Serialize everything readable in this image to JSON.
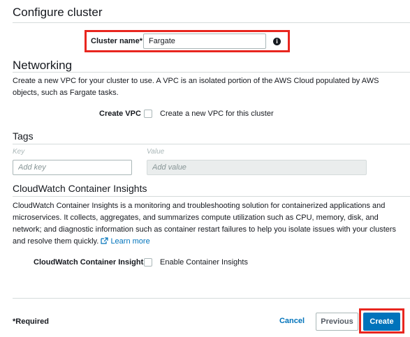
{
  "configure": {
    "title": "Configure cluster"
  },
  "cluster_name": {
    "label": "Cluster name*",
    "value": "Fargate",
    "info_icon": "info-icon"
  },
  "networking": {
    "title": "Networking",
    "description": "Create a new VPC for your cluster to use. A VPC is an isolated portion of the AWS Cloud populated by AWS objects, such as Fargate tasks.",
    "create_vpc_label": "Create VPC",
    "create_vpc_checkbox_label": "Create a new VPC for this cluster"
  },
  "tags": {
    "title": "Tags",
    "key_header": "Key",
    "value_header": "Value",
    "key_placeholder": "Add key",
    "value_placeholder": "Add value"
  },
  "insights": {
    "title": "CloudWatch Container Insights",
    "description": "CloudWatch Container Insights is a monitoring and troubleshooting solution for containerized applications and microservices. It collects, aggregates, and summarizes compute utilization such as CPU, memory, disk, and network; and diagnostic information such as container restart failures to help you isolate issues with your clusters and resolve them quickly.",
    "learn_more": "Learn more",
    "label": "CloudWatch Container Insights",
    "checkbox_label": "Enable Container Insights"
  },
  "footer": {
    "required_note": "*Required",
    "cancel": "Cancel",
    "previous": "Previous",
    "create": "Create"
  },
  "colors": {
    "accent": "#0073bb",
    "highlight": "#e8261f"
  }
}
